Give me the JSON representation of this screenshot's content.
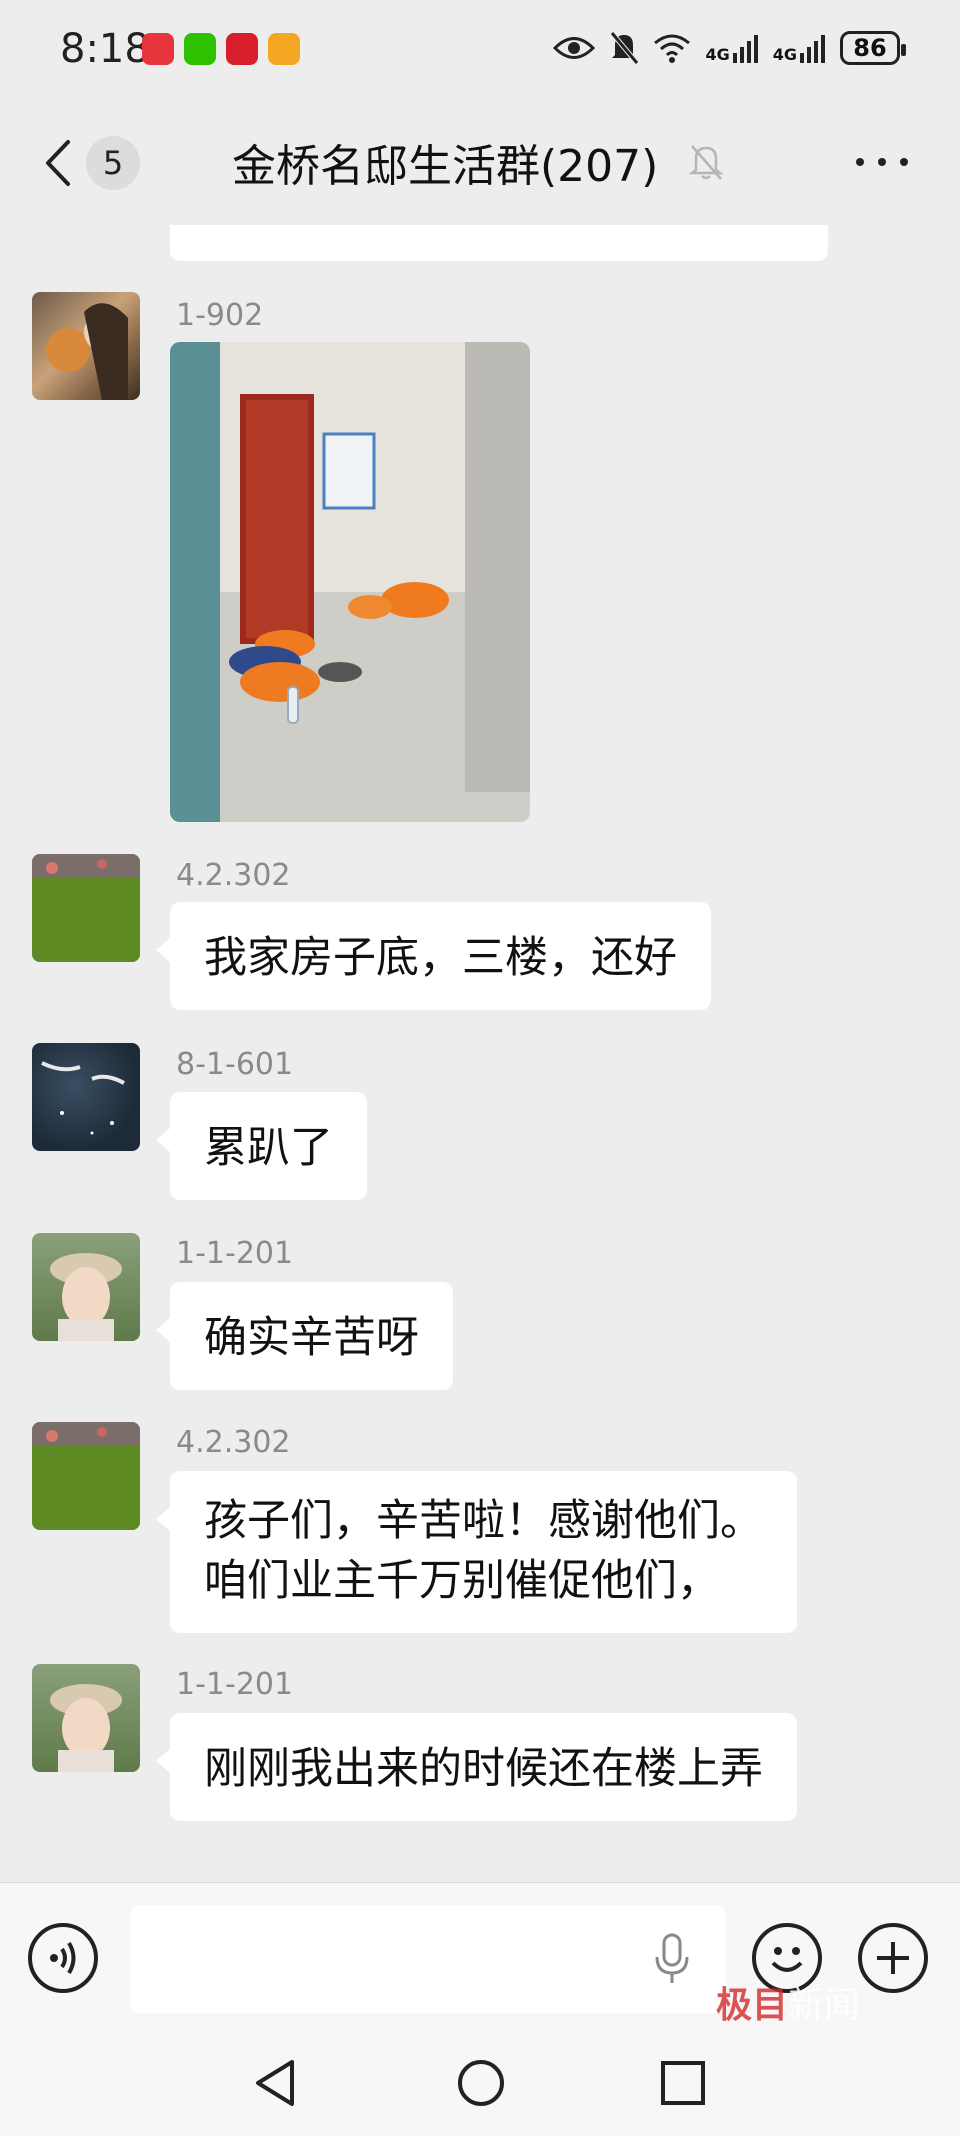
{
  "status_bar": {
    "time": "8:18",
    "battery": "86",
    "network_1": "4G",
    "network_2": "4G"
  },
  "header": {
    "back_label": "<",
    "unread_count": "5",
    "title": "金桥名邸生活群(207)"
  },
  "messages": [
    {
      "sender": "1-902",
      "type": "image",
      "image_desc_icon": "photo-workers-resting"
    },
    {
      "sender": "4.2.302",
      "lines": [
        "我家房子底，三楼，还好"
      ]
    },
    {
      "sender": "8-1-601",
      "lines": [
        "累趴了"
      ]
    },
    {
      "sender": "1-1-201",
      "lines": [
        "确实辛苦呀"
      ]
    },
    {
      "sender": "4.2.302",
      "lines": [
        "孩子们，辛苦啦！感谢他们。",
        "咱们业主千万别催促他们，"
      ]
    },
    {
      "sender": "1-1-201",
      "lines": [
        "刚刚我出来的时候还在楼上弄"
      ]
    }
  ],
  "input": {
    "placeholder": ""
  },
  "watermark": {
    "part1": "极目",
    "part2": "新闻"
  },
  "colors": {
    "background": "#ededed",
    "bubble": "#ffffff",
    "sender_text": "#8a8a8a"
  }
}
